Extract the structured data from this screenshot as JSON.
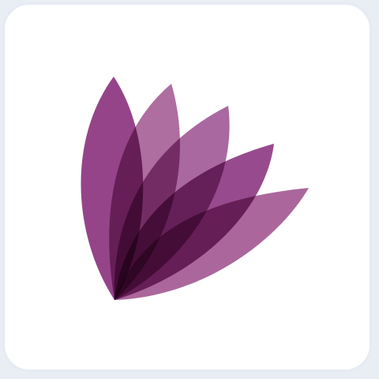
{
  "logo": {
    "name": "lotus-logo-icon",
    "colors": {
      "petal_primary": "#8e3a82",
      "petal_secondary": "#a3588f",
      "petal_deep": "#6d2a74",
      "background": "#ffffff",
      "frame_border": "#e6ebf3"
    },
    "petal_count": 5
  }
}
